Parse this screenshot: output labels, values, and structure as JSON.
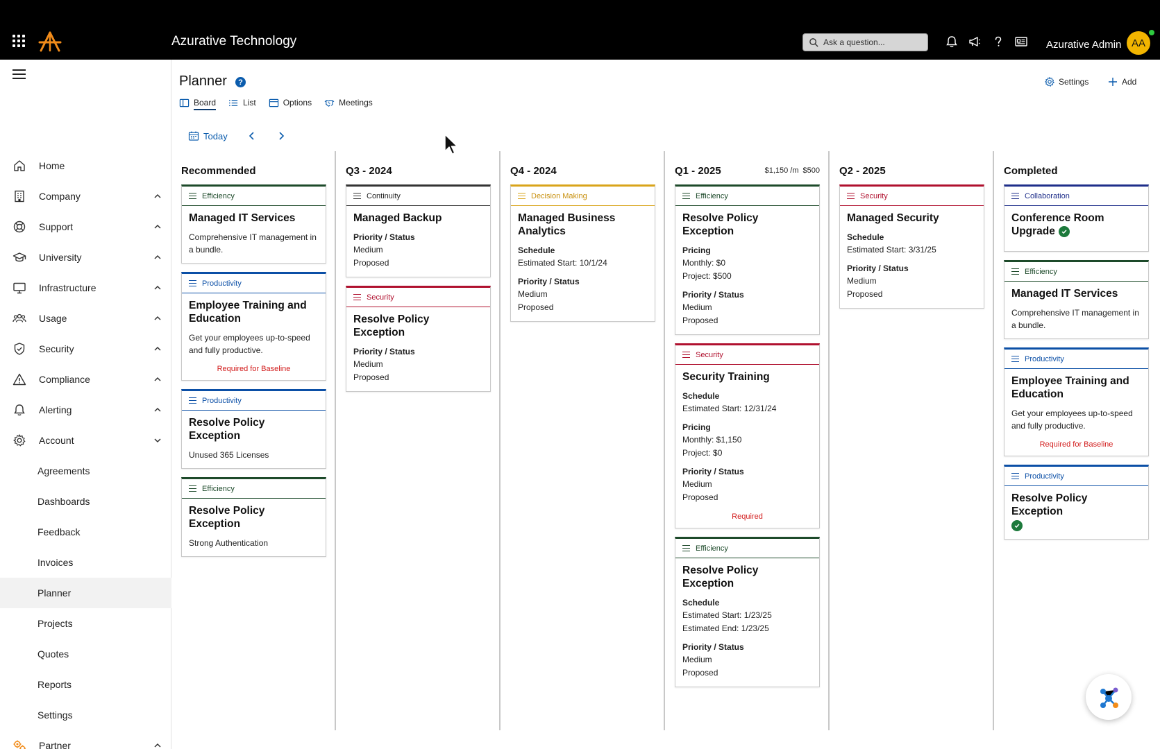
{
  "app": {
    "brand": "Azurative Technology",
    "search_placeholder": "Ask a question...",
    "user_name": "Azurative Admin",
    "user_initials": "AA"
  },
  "sidebar": {
    "items": [
      {
        "label": "Home",
        "icon": "home-icon"
      },
      {
        "label": "Company",
        "icon": "building-icon"
      },
      {
        "label": "Support",
        "icon": "lifebuoy-icon"
      },
      {
        "label": "University",
        "icon": "graduation-cap-icon"
      },
      {
        "label": "Infrastructure",
        "icon": "monitor-icon"
      },
      {
        "label": "Usage",
        "icon": "users-icon"
      },
      {
        "label": "Security",
        "icon": "shield-icon"
      },
      {
        "label": "Compliance",
        "icon": "warning-icon"
      },
      {
        "label": "Alerting",
        "icon": "bell-icon"
      },
      {
        "label": "Account",
        "icon": "gear-icon"
      }
    ],
    "account_sub": [
      "Agreements",
      "Dashboards",
      "Feedback",
      "Invoices",
      "Planner",
      "Projects",
      "Quotes",
      "Reports",
      "Settings"
    ],
    "partner": {
      "label": "Partner",
      "icon": "gears-icon"
    }
  },
  "header": {
    "title": "Planner",
    "tabs": [
      "Board",
      "List",
      "Options",
      "Meetings"
    ],
    "settings_label": "Settings",
    "add_label": "Add",
    "today_label": "Today"
  },
  "columns": [
    {
      "title": "Recommended"
    },
    {
      "title": "Q3 - 2024"
    },
    {
      "title": "Q4 - 2024"
    },
    {
      "title": "Q1 - 2025",
      "monthly": "$1,150 /m",
      "project": "$500"
    },
    {
      "title": "Q2 - 2025"
    },
    {
      "title": "Completed"
    }
  ],
  "cards": {
    "rec1": {
      "tag": "Efficiency",
      "title": "Managed IT Services",
      "desc": "Comprehensive IT management in a bundle."
    },
    "rec2": {
      "tag": "Productivity",
      "title": "Employee Training and Education",
      "desc": "Get your employees up-to-speed and fully productive.",
      "req": "Required for Baseline"
    },
    "rec3": {
      "tag": "Productivity",
      "title": "Resolve Policy Exception",
      "desc": "Unused 365 Licenses"
    },
    "rec4": {
      "tag": "Efficiency",
      "title": "Resolve Policy Exception",
      "desc": "Strong Authentication"
    },
    "q3a": {
      "tag": "Continuity",
      "title": "Managed Backup",
      "ps_label": "Priority / Status",
      "priority": "Medium",
      "status": "Proposed"
    },
    "q3b": {
      "tag": "Security",
      "title": "Resolve Policy Exception",
      "ps_label": "Priority / Status",
      "priority": "Medium",
      "status": "Proposed"
    },
    "q4a": {
      "tag": "Decision Making",
      "title": "Managed Business Analytics",
      "sched_label": "Schedule",
      "start": "Estimated Start: 10/1/24",
      "ps_label": "Priority / Status",
      "priority": "Medium",
      "status": "Proposed"
    },
    "q1a": {
      "tag": "Efficiency",
      "title": "Resolve Policy Exception",
      "pricing_label": "Pricing",
      "monthly": "Monthly: $0",
      "project": "Project: $500",
      "ps_label": "Priority / Status",
      "priority": "Medium",
      "status": "Proposed"
    },
    "q1b": {
      "tag": "Security",
      "title": "Security Training",
      "sched_label": "Schedule",
      "start": "Estimated Start: 12/31/24",
      "pricing_label": "Pricing",
      "monthly": "Monthly: $1,150",
      "project": "Project: $0",
      "ps_label": "Priority / Status",
      "priority": "Medium",
      "status": "Proposed",
      "req": "Required"
    },
    "q1c": {
      "tag": "Efficiency",
      "title": "Resolve Policy Exception",
      "sched_label": "Schedule",
      "start": "Estimated Start: 1/23/25",
      "end": "Estimated End: 1/23/25",
      "ps_label": "Priority / Status",
      "priority": "Medium",
      "status": "Proposed"
    },
    "q2a": {
      "tag": "Security",
      "title": "Managed Security",
      "sched_label": "Schedule",
      "start": "Estimated Start: 3/31/25",
      "ps_label": "Priority / Status",
      "priority": "Medium",
      "status": "Proposed"
    },
    "comp1": {
      "tag": "Collaboration",
      "title": "Conference Room Upgrade"
    },
    "comp2": {
      "tag": "Efficiency",
      "title": "Managed IT Services",
      "desc": "Comprehensive IT management in a bundle."
    },
    "comp3": {
      "tag": "Productivity",
      "title": "Employee Training and Education",
      "desc": "Get your employees up-to-speed and fully productive.",
      "req": "Required for Baseline"
    },
    "comp4": {
      "tag": "Productivity",
      "title": "Resolve Policy Exception"
    }
  }
}
